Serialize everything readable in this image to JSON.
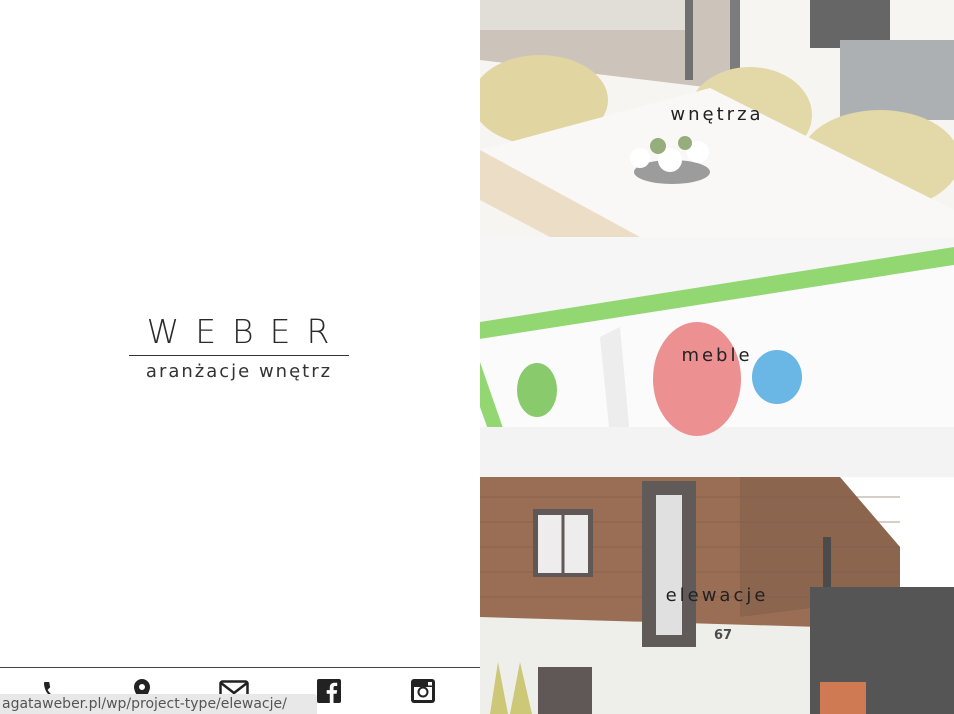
{
  "brand": {
    "name": "WEBER",
    "subtitle": "aranżacje wnętrz"
  },
  "tiles": [
    {
      "label": "wnętrza"
    },
    {
      "label": "meble"
    },
    {
      "label": "elewacje"
    }
  ],
  "social": [
    {
      "icon": "phone-icon"
    },
    {
      "icon": "map-pin-icon"
    },
    {
      "icon": "mail-icon"
    },
    {
      "icon": "facebook-icon"
    },
    {
      "icon": "instagram-icon"
    }
  ],
  "house_number": "67",
  "status_url": "agataweber.pl/wp/project-type/elewacje/",
  "colors": {
    "text": "#222222",
    "green": "#6cc24a",
    "red": "#e9787a",
    "blue": "#4aa8e0",
    "wood": "#8a5a3c"
  }
}
